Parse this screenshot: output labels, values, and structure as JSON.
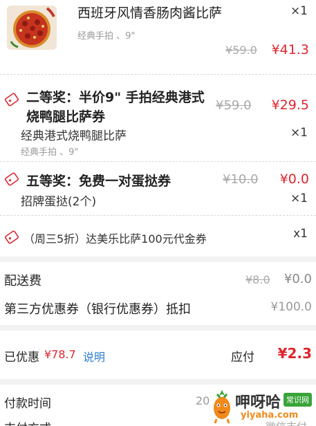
{
  "item1": {
    "name": "西班牙风情香肠肉酱比萨",
    "qty": "×1",
    "spec": "经典手拍 、9\"",
    "orig_price": "¥59.0",
    "price": "¥41.3"
  },
  "prize2": {
    "title_line1": "二等奖：半价9\" 手拍经典港式",
    "title_line2": "烧鸭腿比萨券",
    "orig_price": "¥59.0",
    "price": "¥29.5",
    "item_name": "经典港式烧鸭腿比萨",
    "item_qty": "×1",
    "item_spec": "经典手拍 、9\""
  },
  "prize5": {
    "title": "五等奖：免费一对蛋挞券",
    "orig_price": "¥10.0",
    "price": "¥0.0",
    "item_name": "招牌蛋挞(2个)",
    "item_qty": "×1"
  },
  "voucher": {
    "title": "（周三5折）达美乐比萨100元代金券",
    "qty": "x1"
  },
  "delivery": {
    "label": "配送费",
    "orig": "¥8.0",
    "value": "¥0.0"
  },
  "third_party": {
    "label": "第三方优惠券（银行优惠券）抵扣",
    "value": "¥100.0"
  },
  "summary": {
    "discount_label": "已优惠",
    "discount_value": "¥78.7",
    "explain_link": "说明",
    "payable_label": "应付",
    "payable_value": "¥2.3"
  },
  "payment": {
    "time_label": "付款时间",
    "time_value_partial": "20",
    "method_label_partial": "支付方式",
    "method_value_partial": "微信支付"
  },
  "watermark": {
    "brand": "呷呀哈",
    "badge": "常识网",
    "url": "yiyaha.com"
  },
  "colors": {
    "accent_red": "#e0252e",
    "link_blue": "#2a7ed0",
    "watermark_orange": "#f08a1c",
    "watermark_green": "#3aa43a"
  }
}
